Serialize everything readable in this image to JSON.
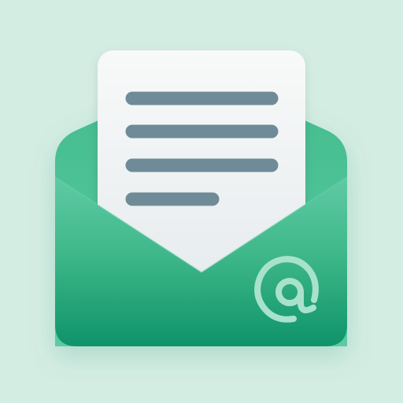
{
  "icon": {
    "name": "mail-at-icon",
    "letter_lines": 4,
    "symbol": "@"
  },
  "colors": {
    "background": "#d4ede3",
    "envelope_top": "#52c39c",
    "envelope_bottom": "#0f936a",
    "envelope_back": "#3fb889",
    "letter_paper": "#f4f6f7",
    "letter_lines": "#6f8b98",
    "at_symbol": "#a8e2cd"
  }
}
